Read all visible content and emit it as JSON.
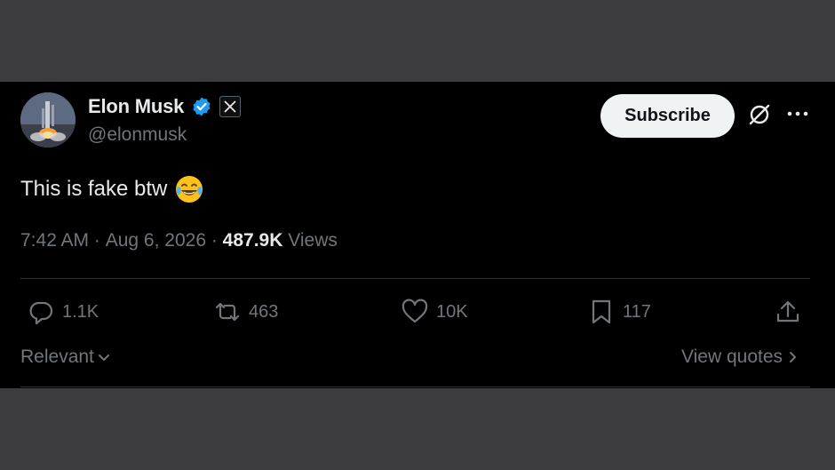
{
  "tweet": {
    "author": {
      "display_name": "Elon Musk",
      "handle": "@elonmusk",
      "verified": true,
      "badge": "x-logo"
    },
    "subscribe_label": "Subscribe",
    "text": "This is fake btw",
    "emoji": "face-with-tears-of-joy",
    "time": "7:42 AM",
    "separator": " · ",
    "date": "Aug 6, 2026",
    "views_count": "487.9K",
    "views_label": " Views",
    "actions": {
      "replies": "1.1K",
      "reposts": "463",
      "likes": "10K",
      "bookmarks": "117"
    },
    "sort_label": "Relevant",
    "view_quotes_label": "View quotes"
  },
  "colors": {
    "page_background": "#3c3c3e",
    "card_background": "#000000",
    "verified_blue": "#1d9bf0",
    "muted_text": "#71767b",
    "primary_text": "#e7e9ea"
  }
}
